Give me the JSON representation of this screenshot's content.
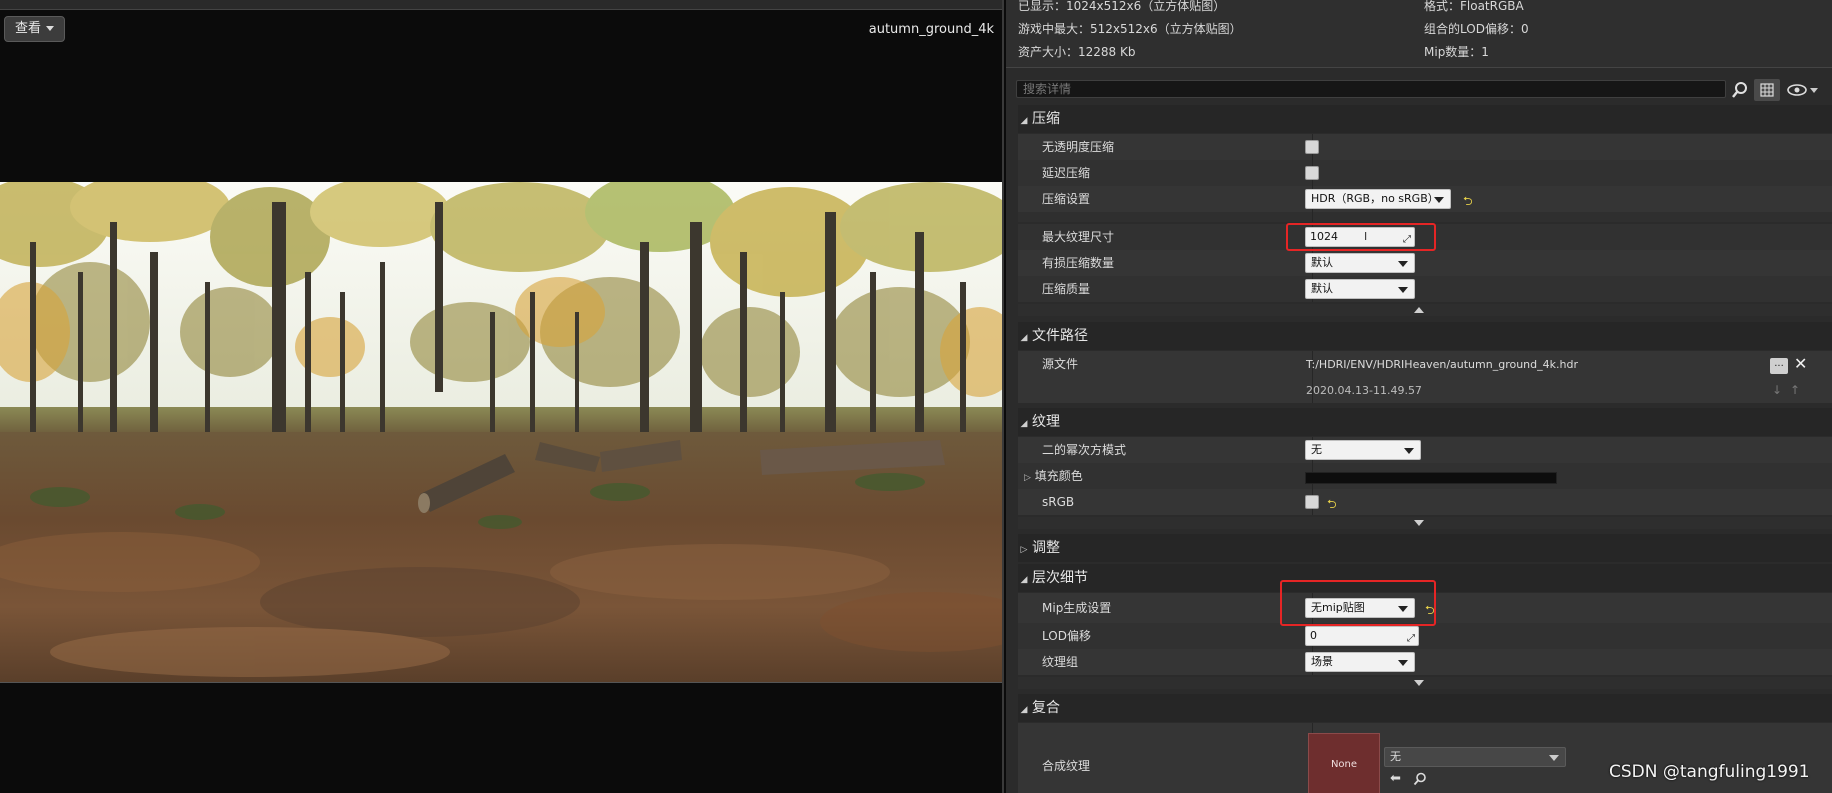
{
  "viewport": {
    "view_button_label": "查看",
    "texture_name": "autumn_ground_4k"
  },
  "info": {
    "displayed": "已显示：1024x512x6（立方体贴图）",
    "max_in_game": "游戏中最大：512x512x6（立方体贴图）",
    "resource_size": "资产大小：12288 Kb",
    "format": "格式：FloatRGBA",
    "combined_lod_bias": "组合的LOD偏移：0",
    "mip_count": "Mip数量：1"
  },
  "search": {
    "placeholder": "搜索详情"
  },
  "compression": {
    "title": "压缩",
    "no_alpha_label": "无透明度压缩",
    "defer_label": "延迟压缩",
    "settings_label": "压缩设置",
    "settings_value": "HDR（RGB，no sRGB）",
    "max_size_label": "最大纹理尺寸",
    "max_size_value": "1024",
    "lossy_label": "有损压缩数量",
    "lossy_value": "默认",
    "quality_label": "压缩质量",
    "quality_value": "默认"
  },
  "file_path": {
    "title": "文件路径",
    "source_label": "源文件",
    "source_path": "T:/HDRI/ENV/HDRIHeaven/autumn_ground_4k.hdr",
    "timestamp": "2020.04.13-11.49.57",
    "browse_label": "..."
  },
  "texture": {
    "title": "纹理",
    "pow2_label": "二的幂次方模式",
    "pow2_value": "无",
    "padding_color_label": "填充颜色",
    "padding_color": "#0d0d0d",
    "srgb_label": "sRGB"
  },
  "adjustments": {
    "title": "调整"
  },
  "lod": {
    "title": "层次细节",
    "mip_gen_label": "Mip生成设置",
    "mip_gen_value": "无mip贴图",
    "lod_bias_label": "LOD偏移",
    "lod_bias_value": "0",
    "texture_group_label": "纹理组",
    "texture_group_value": "场景"
  },
  "composite": {
    "title": "复合",
    "composite_texture_label": "合成纹理",
    "thumb_label": "None",
    "texture_value": "无"
  },
  "watermark": "CSDN @tangfuling1991",
  "colors": {
    "highlight_box": "#e52525",
    "reset_arrow": "#e8d24a"
  }
}
